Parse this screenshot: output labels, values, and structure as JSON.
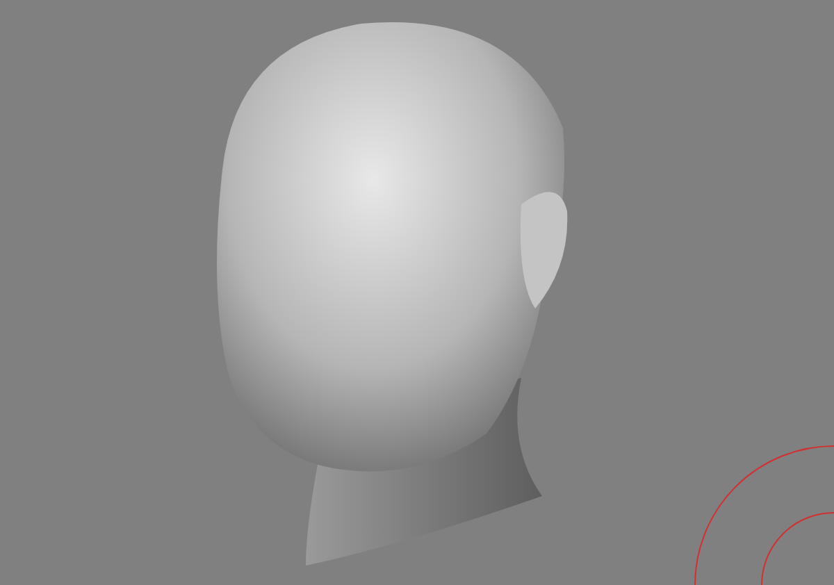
{
  "viewport": {
    "model": {
      "kind": "head"
    },
    "gizmo": {
      "kind": "rotate"
    }
  }
}
